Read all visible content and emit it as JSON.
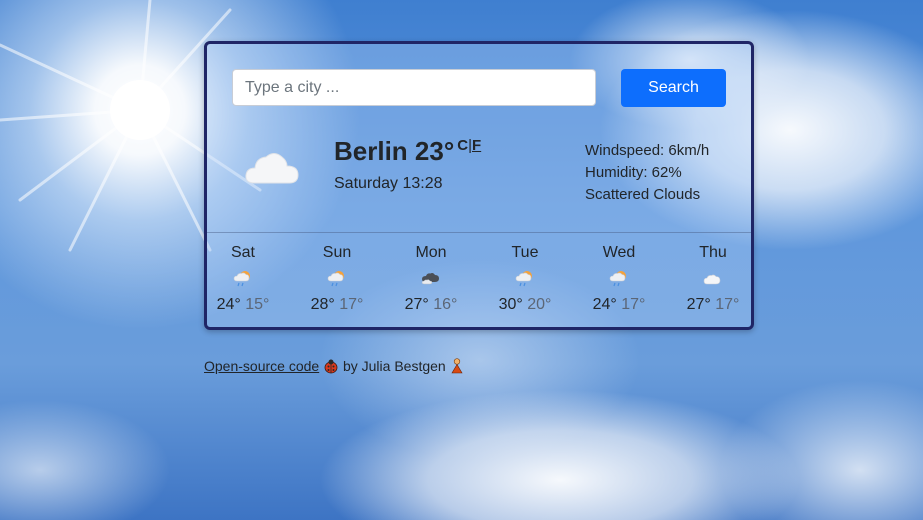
{
  "search": {
    "placeholder": "Type a city ...",
    "value": "",
    "button_label": "Search"
  },
  "current": {
    "city": "Berlin",
    "temperature": "23°",
    "unit_celsius": "C",
    "unit_separator": "|",
    "unit_fahrenheit": "F",
    "datetime": "Saturday 13:28",
    "icon": "cloud-icon",
    "windspeed": "Windspeed: 6km/h",
    "humidity": "Humidity: 62%",
    "description": "Scattered Clouds"
  },
  "forecast": [
    {
      "day": "Sat",
      "max": "24°",
      "min": "15°",
      "icon": "rain-sun-icon"
    },
    {
      "day": "Sun",
      "max": "28°",
      "min": "17°",
      "icon": "rain-sun-icon"
    },
    {
      "day": "Mon",
      "max": "27°",
      "min": "16°",
      "icon": "dark-cloud-icon"
    },
    {
      "day": "Tue",
      "max": "30°",
      "min": "20°",
      "icon": "rain-sun-icon"
    },
    {
      "day": "Wed",
      "max": "24°",
      "min": "17°",
      "icon": "rain-sun-icon"
    },
    {
      "day": "Thu",
      "max": "27°",
      "min": "17°",
      "icon": "cloud-icon"
    }
  ],
  "footer": {
    "link_text": "Open-source code",
    "author_text": "by Julia Bestgen"
  },
  "colors": {
    "card_border": "#1f2566",
    "search_button": "#0d6efd"
  }
}
